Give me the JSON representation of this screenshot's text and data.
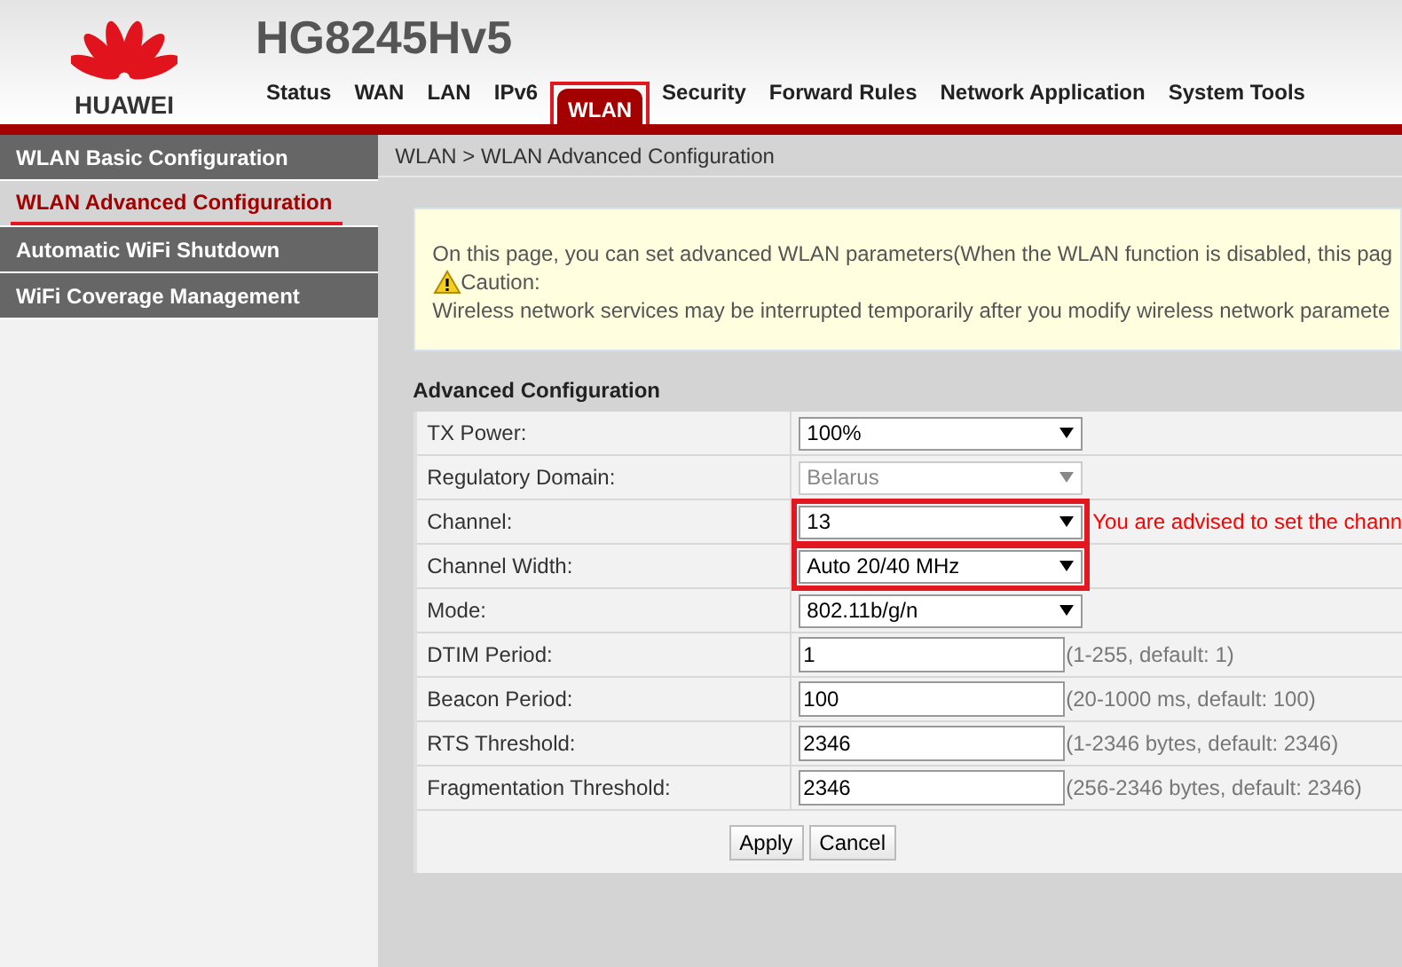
{
  "brand": {
    "logo_text": "HUAWEI",
    "model": "HG8245Hv5"
  },
  "nav_tabs": [
    {
      "label": "Status",
      "selected": false
    },
    {
      "label": "WAN",
      "selected": false
    },
    {
      "label": "LAN",
      "selected": false
    },
    {
      "label": "IPv6",
      "selected": false
    },
    {
      "label": "WLAN",
      "selected": true
    },
    {
      "label": "Security",
      "selected": false
    },
    {
      "label": "Forward Rules",
      "selected": false
    },
    {
      "label": "Network Application",
      "selected": false
    },
    {
      "label": "System Tools",
      "selected": false
    }
  ],
  "sidebar": {
    "items": [
      {
        "label": "WLAN Basic Configuration",
        "selected": false
      },
      {
        "label": "WLAN Advanced Configuration",
        "selected": true
      },
      {
        "label": "Automatic WiFi Shutdown",
        "selected": false
      },
      {
        "label": "WiFi Coverage Management",
        "selected": false
      }
    ]
  },
  "breadcrumb": "WLAN > WLAN Advanced Configuration",
  "notice": {
    "text": "On this page, you can set advanced WLAN parameters(When the WLAN function is disabled, this pag",
    "caution_label": "Caution:",
    "warning": "Wireless network services may be interrupted temporarily after you modify wireless network paramete"
  },
  "form": {
    "title": "Advanced Configuration",
    "rows": [
      {
        "kind": "select",
        "label": "TX Power:",
        "value": "100%",
        "disabled": false,
        "highlighted": false
      },
      {
        "kind": "select",
        "label": "Regulatory Domain:",
        "value": "Belarus",
        "disabled": true,
        "highlighted": false
      },
      {
        "kind": "select",
        "label": "Channel:",
        "value": "13",
        "disabled": false,
        "highlighted": true,
        "advice": "You are advised to set the chann"
      },
      {
        "kind": "select",
        "label": "Channel Width:",
        "value": "Auto 20/40 MHz",
        "disabled": false,
        "highlighted": true
      },
      {
        "kind": "select",
        "label": "Mode:",
        "value": "802.11b/g/n",
        "disabled": false,
        "highlighted": false
      },
      {
        "kind": "input",
        "label": "DTIM Period:",
        "value": "1",
        "hint": "(1-255, default: 1)"
      },
      {
        "kind": "input",
        "label": "Beacon Period:",
        "value": "100",
        "hint": "(20-1000 ms, default: 100)"
      },
      {
        "kind": "input",
        "label": "RTS Threshold:",
        "value": "2346",
        "hint": "(1-2346 bytes, default: 2346)"
      },
      {
        "kind": "input",
        "label": "Fragmentation Threshold:",
        "value": "2346",
        "hint": "(256-2346 bytes, default: 2346)"
      }
    ],
    "buttons": [
      "Apply",
      "Cancel"
    ]
  }
}
